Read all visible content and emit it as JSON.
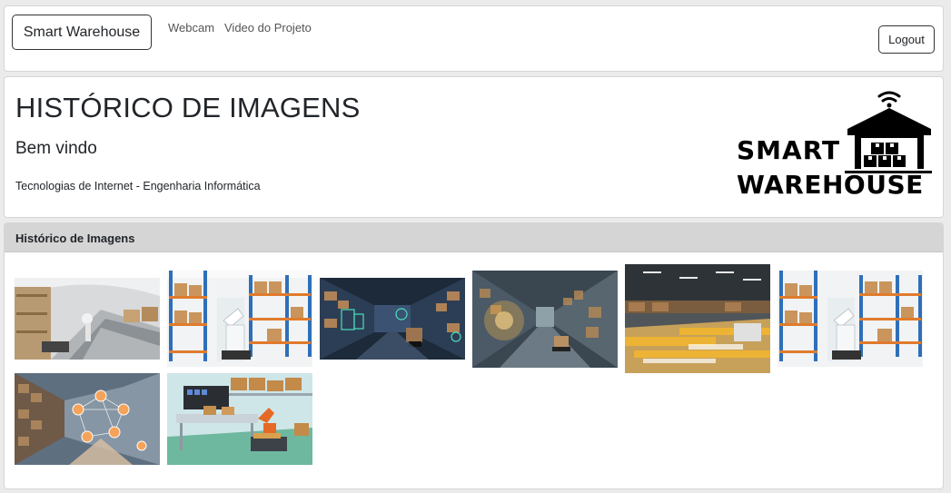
{
  "navbar": {
    "brand": "Smart Warehouse",
    "links": [
      "Webcam",
      "Video do Projeto"
    ],
    "logout": "Logout"
  },
  "header": {
    "title": "HISTÓRICO DE IMAGENS",
    "welcome": "Bem vindo",
    "subtitle": "Tecnologias de Internet - Engenharia Informática",
    "logo_line1": "SMART",
    "logo_line2": "WAREHOUSE"
  },
  "panel": {
    "title": "Histórico de Imagens"
  },
  "images": [
    {
      "name": "warehouse-conveyor-image"
    },
    {
      "name": "warehouse-robot-shelves-image"
    },
    {
      "name": "warehouse-digital-aisle-image"
    },
    {
      "name": "warehouse-blur-aisle-image"
    },
    {
      "name": "warehouse-motion-image"
    },
    {
      "name": "warehouse-robot-shelves-image-2"
    },
    {
      "name": "warehouse-network-icons-image"
    },
    {
      "name": "warehouse-conveyor-robot-image"
    }
  ]
}
